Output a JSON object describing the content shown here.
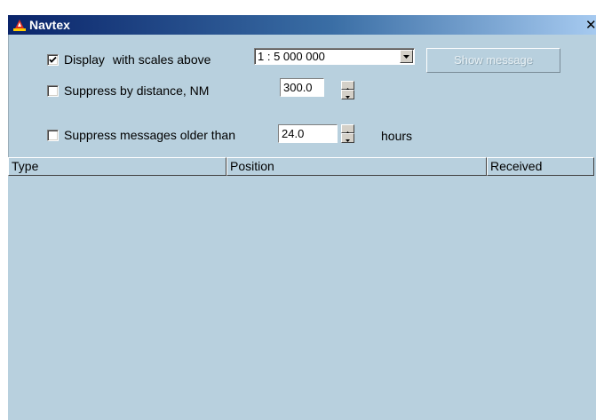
{
  "window": {
    "title": "Navtex",
    "close_glyph": "✕",
    "icon": "navtex-app-icon"
  },
  "display": {
    "checked": true,
    "label": "Display",
    "scale_label": "with scales above",
    "scale_value": "1 : 5 000 000",
    "show_message_label": "Show message",
    "show_message_enabled": false
  },
  "distance": {
    "checked": false,
    "label": "Suppress by distance, NM",
    "value": "300.0"
  },
  "age": {
    "checked": false,
    "label": "Suppress messages older than",
    "value": "24.0",
    "unit": "hours"
  },
  "table": {
    "columns": [
      "Type",
      "Position",
      "Received"
    ],
    "rows": []
  },
  "colors": {
    "background": "#b8d0de",
    "titlebar_start": "#0a246a",
    "titlebar_end": "#a6caf0"
  }
}
